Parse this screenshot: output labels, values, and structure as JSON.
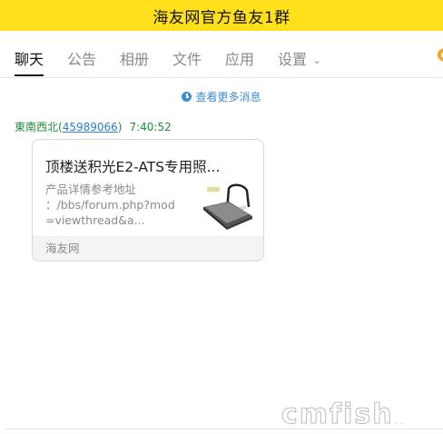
{
  "window": {
    "title": "海友网官方鱼友1群"
  },
  "tabs": [
    {
      "label": "聊天",
      "active": true
    },
    {
      "label": "公告"
    },
    {
      "label": "相册"
    },
    {
      "label": "文件"
    },
    {
      "label": "应用"
    },
    {
      "label": "设置",
      "has_dropdown": true
    }
  ],
  "chat": {
    "load_more": "查看更多消息",
    "message": {
      "sender_name": "東南西北",
      "sender_open": "(",
      "sender_id": "45989066",
      "sender_close": ")",
      "time": "7:40:52",
      "card": {
        "title": "顶楼送积光E2-ATS专用照...",
        "desc_line1": "产品详情参考地址",
        "desc_line2": "：/bbs/forum.php?mod",
        "desc_line3": "=viewthread&a...",
        "source": "海友网"
      }
    }
  },
  "watermark": {
    "text": "cmfish",
    "suffix": "... "
  },
  "colors": {
    "titlebar_bg": "#ffe01b",
    "sender": "#1f8f3a",
    "link": "#2b7fd0",
    "load_more": "#3e8fd6"
  },
  "icons": [
    "clock-icon",
    "chevron-down-icon",
    "lamp-thumbnail",
    "edge-icon"
  ]
}
